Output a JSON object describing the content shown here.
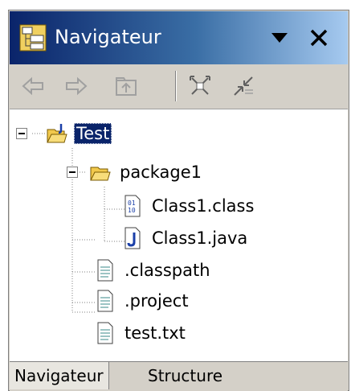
{
  "view": {
    "title": "Navigateur",
    "icon": "navigator-icon",
    "menu_icon": "dropdown-arrow-icon",
    "close_icon": "close-icon"
  },
  "toolbar": {
    "buttons": [
      "back-arrow-icon",
      "forward-arrow-icon",
      "up-folder-icon",
      "collapse-all-icon",
      "link-with-editor-icon"
    ]
  },
  "tree": {
    "items": [
      {
        "label": "Test",
        "icon": "java-project-icon",
        "selected": true
      },
      {
        "label": "package1",
        "icon": "open-folder-icon"
      },
      {
        "label": "Class1.class",
        "icon": "class-file-icon"
      },
      {
        "label": "Class1.java",
        "icon": "java-file-icon"
      },
      {
        "label": ".classpath",
        "icon": "text-file-icon"
      },
      {
        "label": ".project",
        "icon": "text-file-icon"
      },
      {
        "label": "test.txt",
        "icon": "text-file-icon"
      }
    ]
  },
  "tabs": [
    {
      "label": "Navigateur",
      "active": true
    },
    {
      "label": "Structure",
      "active": false
    }
  ],
  "colors": {
    "title_gradient_start": "#0a246a",
    "title_gradient_end": "#a6caf0",
    "selection": "#0a246a",
    "panel": "#d4d0c8"
  }
}
